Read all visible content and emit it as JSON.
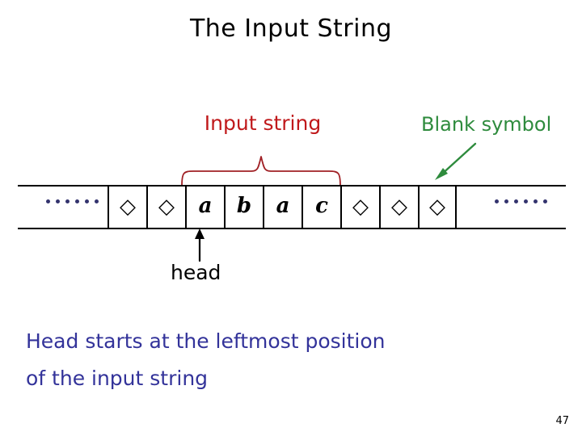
{
  "slide": {
    "title": "The Input String",
    "page_number": "47",
    "background_color": "#ffffff"
  },
  "annotations": {
    "input_string_label": "Input string",
    "input_string_color": "#c0191b",
    "blank_symbol_label": "Blank symbol",
    "blank_symbol_color": "#2e8b3d",
    "head_label": "head",
    "head_color": "#000000"
  },
  "tape": {
    "left_ellipsis": "......",
    "right_ellipsis": "......",
    "ellipsis_dot_count": 6,
    "ellipsis_dot_color": "#33336e",
    "cells": [
      {
        "symbol": "◇",
        "kind": "blank"
      },
      {
        "symbol": "◇",
        "kind": "blank"
      },
      {
        "symbol": "a",
        "kind": "letter"
      },
      {
        "symbol": "b",
        "kind": "letter"
      },
      {
        "symbol": "a",
        "kind": "letter"
      },
      {
        "symbol": "c",
        "kind": "letter"
      },
      {
        "symbol": "◇",
        "kind": "blank"
      },
      {
        "symbol": "◇",
        "kind": "blank"
      },
      {
        "symbol": "◇",
        "kind": "blank"
      }
    ],
    "head_position_index": 2,
    "input_string": "abac",
    "border_color": "#000000"
  },
  "body": {
    "line1": "Head starts at the leftmost position",
    "line2": "of the input string",
    "color": "#33339a"
  }
}
